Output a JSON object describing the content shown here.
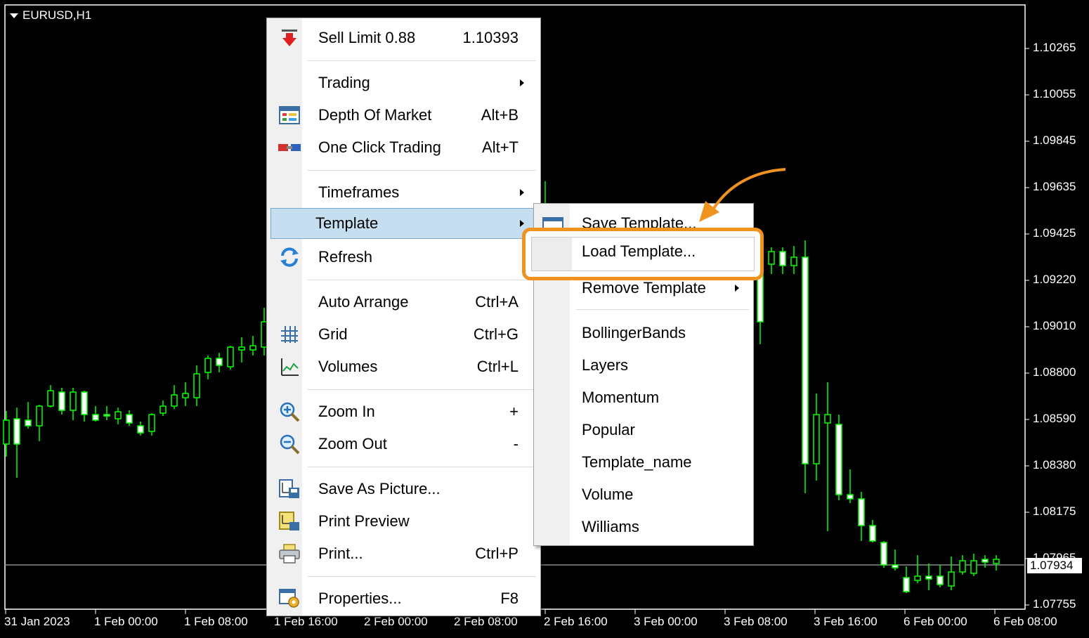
{
  "chart": {
    "symbol": "EURUSD,H1",
    "current_price": "1.07934",
    "price_levels": [
      "1.10265",
      "1.10055",
      "1.09845",
      "1.09635",
      "1.09425",
      "1.09220",
      "1.09010",
      "1.08800",
      "1.08590",
      "1.08380",
      "1.08175",
      "1.07965",
      "1.07755"
    ],
    "time_labels": [
      "31 Jan 2023",
      "1 Feb 00:00",
      "1 Feb 08:00",
      "1 Feb 16:00",
      "2 Feb 00:00",
      "2 Feb 08:00",
      "2 Feb 16:00",
      "3 Feb 00:00",
      "3 Feb 08:00",
      "3 Feb 16:00",
      "6 Feb 00:00",
      "6 Feb 08:00"
    ],
    "candle_color": "#00ff00",
    "background": "#000000"
  },
  "context_menu": {
    "sell_limit": {
      "label": "Sell Limit 0.88",
      "value": "1.10393",
      "icon": "sell-arrow-icon"
    },
    "trading": {
      "label": "Trading"
    },
    "depth_of_market": {
      "label": "Depth Of Market",
      "shortcut": "Alt+B",
      "icon": "depth-of-market-icon"
    },
    "one_click_trading": {
      "label": "One Click Trading",
      "shortcut": "Alt+T",
      "icon": "one-click-trading-icon"
    },
    "timeframes": {
      "label": "Timeframes"
    },
    "template": {
      "label": "Template"
    },
    "refresh": {
      "label": "Refresh",
      "icon": "refresh-icon"
    },
    "auto_arrange": {
      "label": "Auto Arrange",
      "shortcut": "Ctrl+A"
    },
    "grid": {
      "label": "Grid",
      "shortcut": "Ctrl+G",
      "icon": "grid-icon"
    },
    "volumes": {
      "label": "Volumes",
      "shortcut": "Ctrl+L",
      "icon": "volumes-icon"
    },
    "zoom_in": {
      "label": "Zoom In",
      "shortcut": "+",
      "icon": "zoom-in-icon"
    },
    "zoom_out": {
      "label": "Zoom Out",
      "shortcut": "-",
      "icon": "zoom-out-icon"
    },
    "save_as_picture": {
      "label": "Save As Picture...",
      "icon": "save-picture-icon"
    },
    "print_preview": {
      "label": "Print Preview",
      "icon": "print-preview-icon"
    },
    "print": {
      "label": "Print...",
      "shortcut": "Ctrl+P",
      "icon": "printer-icon"
    },
    "properties": {
      "label": "Properties...",
      "shortcut": "F8",
      "icon": "properties-icon"
    }
  },
  "template_submenu": {
    "save_template": "Save Template...",
    "load_template": "Load Template...",
    "remove_template": "Remove Template",
    "templates": [
      "BollingerBands",
      "Layers",
      "Momentum",
      "Popular",
      "Template_name",
      "Volume",
      "Williams"
    ]
  },
  "highlight_color": "#f0921e"
}
